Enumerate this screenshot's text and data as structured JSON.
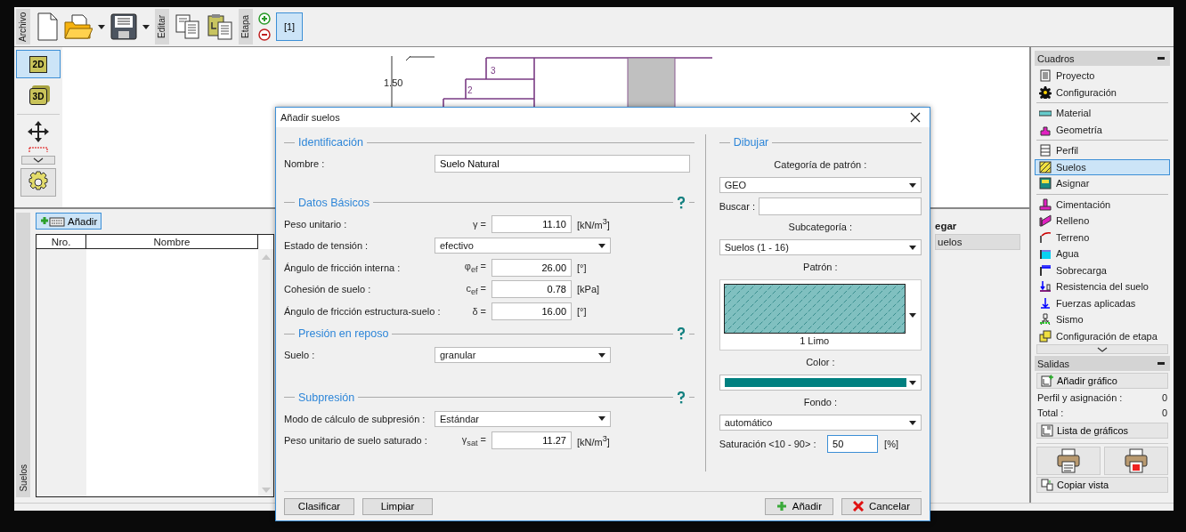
{
  "toolbar": {
    "file_label": "Archivo",
    "edit_label": "Editar",
    "stage_label": "Etapa",
    "stages": [
      {
        "label": "[1]",
        "selected": true
      }
    ]
  },
  "view_tools": [
    {
      "label": "2D",
      "selected": true
    },
    {
      "label": "3D",
      "selected": false
    }
  ],
  "drawing": {
    "dimension": "1.50",
    "layer_numbers": [
      "3",
      "2"
    ]
  },
  "soils_panel": {
    "tab": "Suelos",
    "add_button": "Añadir",
    "columns": [
      "Nro.",
      "Nombre"
    ]
  },
  "side_fragment": {
    "header": "egar",
    "row": "uelos"
  },
  "dialog": {
    "title": "Añadir suelos",
    "left_sections": [
      {
        "title": "Identificación",
        "help": false,
        "rows": [
          {
            "kind": "text",
            "label": "Nombre :",
            "value": "Suelo Natural"
          }
        ]
      },
      {
        "title": "Datos Básicos",
        "help": true,
        "rows": [
          {
            "kind": "number",
            "label": "Peso unitario :",
            "symbol": "γ =",
            "value": "11.10",
            "unit": "[kN/m$^{3}$]"
          },
          {
            "kind": "select",
            "label": "Estado de tensión :",
            "value": "efectivo"
          },
          {
            "kind": "number",
            "label": "Ángulo de fricción interna :",
            "symbol": "φ$_{ef}$ =",
            "value": "26.00",
            "unit": "[°]"
          },
          {
            "kind": "number",
            "label": "Cohesión de suelo :",
            "symbol": "c$_{ef}$ =",
            "value": "0.78",
            "unit": "[kPa]"
          },
          {
            "kind": "number",
            "label": "Ángulo de fricción estructura-suelo :",
            "symbol": "δ =",
            "value": "16.00",
            "unit": "[°]"
          }
        ]
      },
      {
        "title": "Presión en reposo",
        "help": true,
        "rows": [
          {
            "kind": "select",
            "label": "Suelo :",
            "value": "granular"
          }
        ]
      },
      {
        "title": "Subpresión",
        "help": true,
        "rows": [
          {
            "kind": "select",
            "label": "Modo de cálculo de subpresión :",
            "value": "Estándar"
          },
          {
            "kind": "number",
            "label": "Peso unitario de suelo saturado :",
            "symbol": "γ$_{sat}$ =",
            "value": "11.27",
            "unit": "[kN/m$^{3}$]"
          }
        ]
      }
    ],
    "draw": {
      "title": "Dibujar",
      "category_label": "Categoría de patrón :",
      "category": "GEO",
      "search_label": "Buscar :",
      "subcategory_label": "Subcategoría :",
      "subcategory": "Suelos (1 - 16)",
      "pattern_label": "Patrón :",
      "pattern_name": "1 Limo",
      "color_label": "Color :",
      "color": "#008080",
      "background_label": "Fondo :",
      "background": "automático",
      "saturation_label": "Saturación <10 - 90> :",
      "saturation": "50",
      "saturation_unit": "[%]"
    },
    "footer_left": [
      "Clasificar",
      "Limpiar"
    ],
    "add_button": "Añadir",
    "cancel_button": "Cancelar"
  },
  "frames": {
    "title": "Cuadros",
    "groups": [
      {
        "items": [
          {
            "label": "Proyecto",
            "selected": false
          },
          {
            "label": "Configuración",
            "selected": false
          }
        ]
      },
      {
        "items": [
          {
            "label": "Material",
            "selected": false
          },
          {
            "label": "Geometría",
            "selected": false
          }
        ]
      },
      {
        "items": [
          {
            "label": "Perfil",
            "selected": false
          },
          {
            "label": "Suelos",
            "selected": true
          },
          {
            "label": "Asignar",
            "selected": false
          }
        ]
      },
      {
        "items": [
          {
            "label": "Cimentación",
            "selected": false
          },
          {
            "label": "Relleno",
            "selected": false
          },
          {
            "label": "Terreno",
            "selected": false
          },
          {
            "label": "Agua",
            "selected": false
          },
          {
            "label": "Sobrecarga",
            "selected": false
          },
          {
            "label": "Resistencia del suelo",
            "selected": false
          },
          {
            "label": "Fuerzas aplicadas",
            "selected": false
          },
          {
            "label": "Sismo",
            "selected": false
          },
          {
            "label": "Configuración de etapa",
            "selected": false
          }
        ]
      }
    ]
  },
  "outputs": {
    "title": "Salidas",
    "add_chart": "Añadir gráfico",
    "stats": [
      {
        "label": "Perfil y asignación :",
        "value": "0"
      },
      {
        "label": "Total :",
        "value": "0"
      }
    ],
    "chart_list": "Lista de gráficos",
    "copy_view": "Copiar vista"
  }
}
